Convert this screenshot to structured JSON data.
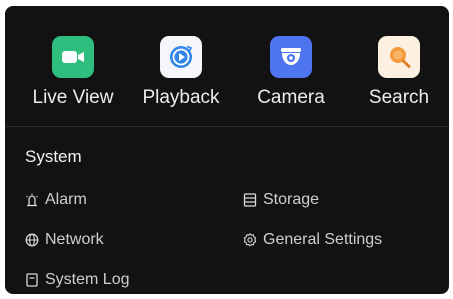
{
  "apps": [
    {
      "label": "Live View",
      "icon": "video-camera-icon",
      "color": "#2ebf7f"
    },
    {
      "label": "Playback",
      "icon": "playback-icon",
      "color": "#f4f6fa"
    },
    {
      "label": "Camera",
      "icon": "dome-camera-icon",
      "color": "#4f74f0"
    },
    {
      "label": "Search",
      "icon": "search-icon",
      "color": "#fdf0e3"
    }
  ],
  "system": {
    "title": "System",
    "items": [
      {
        "label": "Alarm",
        "icon": "alarm-icon"
      },
      {
        "label": "Storage",
        "icon": "storage-icon"
      },
      {
        "label": "Network",
        "icon": "network-icon"
      },
      {
        "label": "General Settings",
        "icon": "gear-icon"
      },
      {
        "label": "System Log",
        "icon": "log-icon"
      }
    ]
  },
  "colors": {
    "background": "#121212",
    "text": "#ececec",
    "muted_text": "#cfcfcf",
    "divider": "#2c2c2c"
  }
}
